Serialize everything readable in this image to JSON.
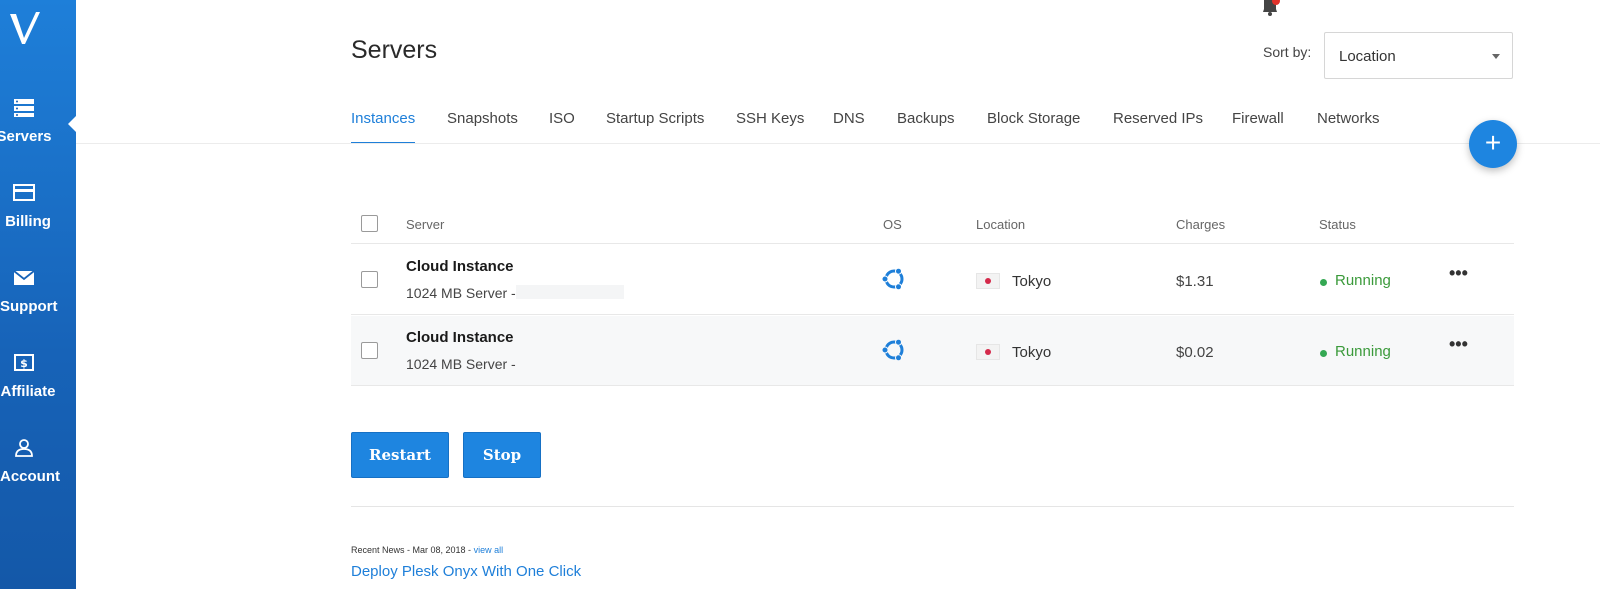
{
  "brand": {
    "logo_text": "V",
    "accent": "#1e7fd9"
  },
  "sidebar": {
    "items": [
      {
        "label": "Servers",
        "icon": "server-icon",
        "active": true
      },
      {
        "label": "Billing",
        "icon": "credit-card-icon"
      },
      {
        "label": "Support",
        "icon": "envelope-icon"
      },
      {
        "label": "Affiliate",
        "icon": "dollar-icon"
      },
      {
        "label": "Account",
        "icon": "user-icon"
      }
    ]
  },
  "header": {
    "title": "Servers",
    "sort_label": "Sort by:",
    "sort_value": "Location"
  },
  "tabs": [
    {
      "label": "Instances",
      "active": true
    },
    {
      "label": "Snapshots"
    },
    {
      "label": "ISO"
    },
    {
      "label": "Startup Scripts"
    },
    {
      "label": "SSH Keys"
    },
    {
      "label": "DNS"
    },
    {
      "label": "Backups"
    },
    {
      "label": "Block Storage"
    },
    {
      "label": "Reserved IPs"
    },
    {
      "label": "Firewall"
    },
    {
      "label": "Networks"
    }
  ],
  "add_button": "+",
  "table": {
    "columns": {
      "server": "Server",
      "os": "OS",
      "location": "Location",
      "charges": "Charges",
      "status": "Status"
    },
    "rows": [
      {
        "name": "Cloud Instance",
        "sub": "1024 MB Server -",
        "os_icon": "ubuntu-icon",
        "location": "Tokyo",
        "flag": "japan-flag",
        "charges": "$1.31",
        "status": "Running",
        "more": "•••"
      },
      {
        "name": "Cloud Instance",
        "sub": "1024 MB Server -",
        "os_icon": "ubuntu-icon",
        "location": "Tokyo",
        "flag": "japan-flag",
        "charges": "$0.02",
        "status": "Running",
        "more": "•••"
      }
    ]
  },
  "actions": {
    "restart": "Restart",
    "stop": "Stop"
  },
  "news": {
    "meta": "Recent News - Mar 08, 2018 -",
    "view_all": "view all",
    "headline": "Deploy Plesk Onyx With One Click"
  }
}
